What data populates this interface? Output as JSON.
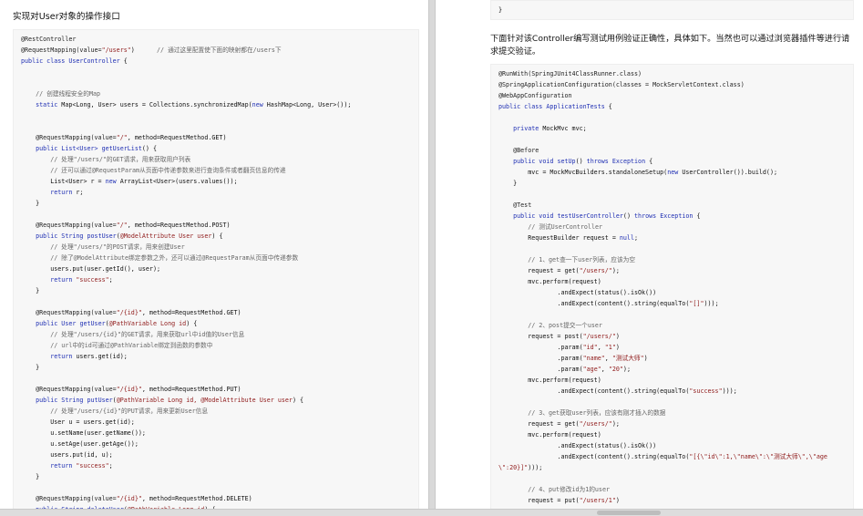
{
  "left_page": {
    "heading": "实现对User对象的操作接口",
    "code_lines": [
      [
        {
          "t": "@RestController",
          "k": "ann"
        }
      ],
      [
        {
          "t": "@RequestMapping(value=",
          "k": "ann"
        },
        {
          "t": "\"/users\"",
          "k": "str"
        },
        {
          "t": ")      ",
          "k": "plain"
        },
        {
          "t": "// 通过这里配置使下面的映射都在/users下",
          "k": "cmt"
        }
      ],
      [
        {
          "t": "public class ",
          "k": "kw"
        },
        {
          "t": "UserController",
          "k": "id"
        },
        {
          "t": " {",
          "k": "plain"
        }
      ],
      [],
      [],
      [
        {
          "t": "    // 创建线程安全的Map",
          "k": "cmt"
        }
      ],
      [
        {
          "t": "    ",
          "k": "plain"
        },
        {
          "t": "static ",
          "k": "kw"
        },
        {
          "t": "Map<Long, User> users = Collections.synchronizedMap(",
          "k": "plain"
        },
        {
          "t": "new ",
          "k": "kw"
        },
        {
          "t": "HashMap<Long, User>());",
          "k": "plain"
        }
      ],
      [],
      [],
      [
        {
          "t": "    @RequestMapping(value=",
          "k": "ann"
        },
        {
          "t": "\"/\"",
          "k": "str"
        },
        {
          "t": ", method=RequestMethod.GET)",
          "k": "plain"
        }
      ],
      [
        {
          "t": "    ",
          "k": "plain"
        },
        {
          "t": "public ",
          "k": "kw"
        },
        {
          "t": "List<User> ",
          "k": "kw"
        },
        {
          "t": "getUserList",
          "k": "id"
        },
        {
          "t": "() {",
          "k": "plain"
        }
      ],
      [
        {
          "t": "        // 处理\"/users/\"的GET请求，用来获取用户列表",
          "k": "cmt"
        }
      ],
      [
        {
          "t": "        // 还可以通过@RequestParam从页面中传递参数来进行查询条件或者翻页信息的传递",
          "k": "cmt"
        }
      ],
      [
        {
          "t": "        List<User> r = ",
          "k": "plain"
        },
        {
          "t": "new ",
          "k": "kw"
        },
        {
          "t": "ArrayList<User>(users.values());",
          "k": "plain"
        }
      ],
      [
        {
          "t": "        ",
          "k": "plain"
        },
        {
          "t": "return ",
          "k": "kw"
        },
        {
          "t": "r;",
          "k": "plain"
        }
      ],
      [
        {
          "t": "    }",
          "k": "plain"
        }
      ],
      [],
      [
        {
          "t": "    @RequestMapping(value=",
          "k": "ann"
        },
        {
          "t": "\"/\"",
          "k": "str"
        },
        {
          "t": ", method=RequestMethod.POST)",
          "k": "plain"
        }
      ],
      [
        {
          "t": "    ",
          "k": "plain"
        },
        {
          "t": "public ",
          "k": "kw"
        },
        {
          "t": "String ",
          "k": "kw"
        },
        {
          "t": "postUser",
          "k": "id"
        },
        {
          "t": "(",
          "k": "plain"
        },
        {
          "t": "@ModelAttribute User user",
          "k": "str"
        },
        {
          "t": ") {",
          "k": "plain"
        }
      ],
      [
        {
          "t": "        // 处理\"/users/\"的POST请求，用来创建User",
          "k": "cmt"
        }
      ],
      [
        {
          "t": "        // 除了@ModelAttribute绑定参数之外，还可以通过@RequestParam从页面中传递参数",
          "k": "cmt"
        }
      ],
      [
        {
          "t": "        users.put(user.getId(), user);",
          "k": "plain"
        }
      ],
      [
        {
          "t": "        ",
          "k": "plain"
        },
        {
          "t": "return ",
          "k": "kw"
        },
        {
          "t": "\"success\"",
          "k": "str"
        },
        {
          "t": ";",
          "k": "plain"
        }
      ],
      [
        {
          "t": "    }",
          "k": "plain"
        }
      ],
      [],
      [
        {
          "t": "    @RequestMapping(value=",
          "k": "ann"
        },
        {
          "t": "\"/{id}\"",
          "k": "str"
        },
        {
          "t": ", method=RequestMethod.GET)",
          "k": "plain"
        }
      ],
      [
        {
          "t": "    ",
          "k": "plain"
        },
        {
          "t": "public ",
          "k": "kw"
        },
        {
          "t": "User ",
          "k": "kw"
        },
        {
          "t": "getUser",
          "k": "id"
        },
        {
          "t": "(",
          "k": "plain"
        },
        {
          "t": "@PathVariable Long id",
          "k": "str"
        },
        {
          "t": ") {",
          "k": "plain"
        }
      ],
      [
        {
          "t": "        // 处理\"/users/{id}\"的GET请求，用来获取url中id值的User信息",
          "k": "cmt"
        }
      ],
      [
        {
          "t": "        // url中的id可通过@PathVariable绑定到函数的参数中",
          "k": "cmt"
        }
      ],
      [
        {
          "t": "        ",
          "k": "plain"
        },
        {
          "t": "return ",
          "k": "kw"
        },
        {
          "t": "users.get(id);",
          "k": "plain"
        }
      ],
      [
        {
          "t": "    }",
          "k": "plain"
        }
      ],
      [],
      [
        {
          "t": "    @RequestMapping(value=",
          "k": "ann"
        },
        {
          "t": "\"/{id}\"",
          "k": "str"
        },
        {
          "t": ", method=RequestMethod.PUT)",
          "k": "plain"
        }
      ],
      [
        {
          "t": "    ",
          "k": "plain"
        },
        {
          "t": "public ",
          "k": "kw"
        },
        {
          "t": "String ",
          "k": "kw"
        },
        {
          "t": "putUser",
          "k": "id"
        },
        {
          "t": "(",
          "k": "plain"
        },
        {
          "t": "@PathVariable Long id, @ModelAttribute User user",
          "k": "str"
        },
        {
          "t": ") {",
          "k": "plain"
        }
      ],
      [
        {
          "t": "        // 处理\"/users/{id}\"的PUT请求，用来更新User信息",
          "k": "cmt"
        }
      ],
      [
        {
          "t": "        User u = users.get(id);",
          "k": "plain"
        }
      ],
      [
        {
          "t": "        u.setName(user.getName());",
          "k": "plain"
        }
      ],
      [
        {
          "t": "        u.setAge(user.getAge());",
          "k": "plain"
        }
      ],
      [
        {
          "t": "        users.put(id, u);",
          "k": "plain"
        }
      ],
      [
        {
          "t": "        ",
          "k": "plain"
        },
        {
          "t": "return ",
          "k": "kw"
        },
        {
          "t": "\"success\"",
          "k": "str"
        },
        {
          "t": ";",
          "k": "plain"
        }
      ],
      [
        {
          "t": "    }",
          "k": "plain"
        }
      ],
      [],
      [
        {
          "t": "    @RequestMapping(value=",
          "k": "ann"
        },
        {
          "t": "\"/{id}\"",
          "k": "str"
        },
        {
          "t": ", method=RequestMethod.DELETE)",
          "k": "plain"
        }
      ],
      [
        {
          "t": "    ",
          "k": "plain"
        },
        {
          "t": "public ",
          "k": "kw"
        },
        {
          "t": "String ",
          "k": "kw"
        },
        {
          "t": "deleteUser",
          "k": "id"
        },
        {
          "t": "(",
          "k": "plain"
        },
        {
          "t": "@PathVariable Long id",
          "k": "str"
        },
        {
          "t": ") {",
          "k": "plain"
        }
      ]
    ]
  },
  "right_page": {
    "top_code_lines": [
      [
        {
          "t": "}",
          "k": "plain"
        }
      ]
    ],
    "heading": "下面针对该Controller编写测试用例验证正确性，具体如下。当然也可以通过浏览器插件等进行请求提交验证。",
    "code_lines": [
      [
        {
          "t": "@RunWith(SpringJUnit4ClassRunner.class)",
          "k": "ann"
        }
      ],
      [
        {
          "t": "@SpringApplicationConfiguration(classes = MockServletContext.class)",
          "k": "ann"
        }
      ],
      [
        {
          "t": "@WebAppConfiguration",
          "k": "ann"
        }
      ],
      [
        {
          "t": "public class ",
          "k": "kw"
        },
        {
          "t": "ApplicationTests",
          "k": "id"
        },
        {
          "t": " {",
          "k": "plain"
        }
      ],
      [],
      [
        {
          "t": "    ",
          "k": "plain"
        },
        {
          "t": "private ",
          "k": "kw"
        },
        {
          "t": "MockMvc mvc;",
          "k": "plain"
        }
      ],
      [],
      [
        {
          "t": "    @Before",
          "k": "ann"
        }
      ],
      [
        {
          "t": "    ",
          "k": "plain"
        },
        {
          "t": "public void ",
          "k": "kw"
        },
        {
          "t": "setUp",
          "k": "id"
        },
        {
          "t": "() ",
          "k": "plain"
        },
        {
          "t": "throws ",
          "k": "kw"
        },
        {
          "t": "Exception",
          "k": "kw"
        },
        {
          "t": " {",
          "k": "plain"
        }
      ],
      [
        {
          "t": "        mvc = MockMvcBuilders.standaloneSetup(",
          "k": "plain"
        },
        {
          "t": "new ",
          "k": "kw"
        },
        {
          "t": "UserController()).build();",
          "k": "plain"
        }
      ],
      [
        {
          "t": "    }",
          "k": "plain"
        }
      ],
      [],
      [
        {
          "t": "    @Test",
          "k": "ann"
        }
      ],
      [
        {
          "t": "    ",
          "k": "plain"
        },
        {
          "t": "public void ",
          "k": "kw"
        },
        {
          "t": "testUserController",
          "k": "id"
        },
        {
          "t": "() ",
          "k": "plain"
        },
        {
          "t": "throws ",
          "k": "kw"
        },
        {
          "t": "Exception",
          "k": "kw"
        },
        {
          "t": " {",
          "k": "plain"
        }
      ],
      [
        {
          "t": "        // 测试UserController",
          "k": "cmt"
        }
      ],
      [
        {
          "t": "        RequestBuilder request = ",
          "k": "plain"
        },
        {
          "t": "null",
          "k": "kw"
        },
        {
          "t": ";",
          "k": "plain"
        }
      ],
      [],
      [
        {
          "t": "        // 1、get查一下user列表，应该为空",
          "k": "cmt"
        }
      ],
      [
        {
          "t": "        request = get(",
          "k": "plain"
        },
        {
          "t": "\"/users/\"",
          "k": "str"
        },
        {
          "t": ");",
          "k": "plain"
        }
      ],
      [
        {
          "t": "        mvc.perform(request)",
          "k": "plain"
        }
      ],
      [
        {
          "t": "                .andExpect(status().isOk())",
          "k": "plain"
        }
      ],
      [
        {
          "t": "                .andExpect(content().string(equalTo(",
          "k": "plain"
        },
        {
          "t": "\"[]\"",
          "k": "str"
        },
        {
          "t": ")));",
          "k": "plain"
        }
      ],
      [],
      [
        {
          "t": "        // 2、post提交一个user",
          "k": "cmt"
        }
      ],
      [
        {
          "t": "        request = post(",
          "k": "plain"
        },
        {
          "t": "\"/users/\"",
          "k": "str"
        },
        {
          "t": ")",
          "k": "plain"
        }
      ],
      [
        {
          "t": "                .param(",
          "k": "plain"
        },
        {
          "t": "\"id\"",
          "k": "str"
        },
        {
          "t": ", ",
          "k": "plain"
        },
        {
          "t": "\"1\"",
          "k": "str"
        },
        {
          "t": ")",
          "k": "plain"
        }
      ],
      [
        {
          "t": "                .param(",
          "k": "plain"
        },
        {
          "t": "\"name\"",
          "k": "str"
        },
        {
          "t": ", ",
          "k": "plain"
        },
        {
          "t": "\"测试大师\"",
          "k": "str"
        },
        {
          "t": ")",
          "k": "plain"
        }
      ],
      [
        {
          "t": "                .param(",
          "k": "plain"
        },
        {
          "t": "\"age\"",
          "k": "str"
        },
        {
          "t": ", ",
          "k": "plain"
        },
        {
          "t": "\"20\"",
          "k": "str"
        },
        {
          "t": ");",
          "k": "plain"
        }
      ],
      [
        {
          "t": "        mvc.perform(request)",
          "k": "plain"
        }
      ],
      [
        {
          "t": "                .andExpect(content().string(equalTo(",
          "k": "plain"
        },
        {
          "t": "\"success\"",
          "k": "str"
        },
        {
          "t": ")));",
          "k": "plain"
        }
      ],
      [],
      [
        {
          "t": "        // 3、get获取user列表，应该有刚才插入的数据",
          "k": "cmt"
        }
      ],
      [
        {
          "t": "        request = get(",
          "k": "plain"
        },
        {
          "t": "\"/users/\"",
          "k": "str"
        },
        {
          "t": ");",
          "k": "plain"
        }
      ],
      [
        {
          "t": "        mvc.perform(request)",
          "k": "plain"
        }
      ],
      [
        {
          "t": "                .andExpect(status().isOk())",
          "k": "plain"
        }
      ],
      [
        {
          "t": "                .andExpect(content().string(equalTo(",
          "k": "plain"
        },
        {
          "t": "\"[{\\\"id\\\":1,\\\"name\\\":\\\"测试大师\\\",\\\"age",
          "k": "str"
        }
      ],
      [
        {
          "t": "\\\":20}]\"",
          "k": "str"
        },
        {
          "t": ")));",
          "k": "plain"
        }
      ],
      [],
      [
        {
          "t": "        // 4、put修改id为1的user",
          "k": "cmt"
        }
      ],
      [
        {
          "t": "        request = put(",
          "k": "plain"
        },
        {
          "t": "\"/users/1\"",
          "k": "str"
        },
        {
          "t": ")",
          "k": "plain"
        }
      ]
    ]
  },
  "colors": {
    "keyword": "#1f2fb3",
    "string": "#8f1a1a",
    "comment": "#666666",
    "code_background": "#f7f7f7",
    "gutter": "#d9d9d9"
  }
}
